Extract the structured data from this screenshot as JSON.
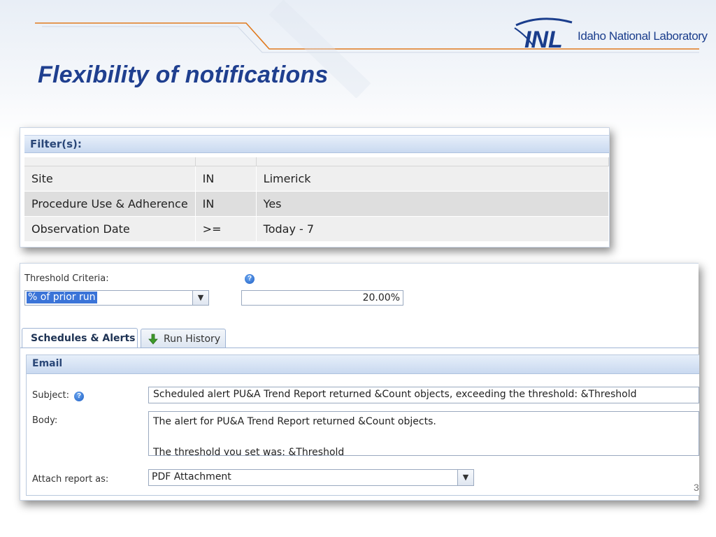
{
  "slide": {
    "title": "Flexibility of notifications",
    "logo_abbrev": "INL",
    "logo_text": "Idaho National Laboratory",
    "page_number": "3",
    "colors": {
      "title": "#1f3f8f",
      "accent_line": "#e07a1f",
      "header_fill": "#c9d9f0"
    }
  },
  "filters": {
    "header": "Filter(s):",
    "rows": [
      {
        "field": "Site",
        "operator": "IN",
        "value": "Limerick"
      },
      {
        "field": "Procedure Use & Adherence",
        "operator": "IN",
        "value": "Yes"
      },
      {
        "field": "Observation Date",
        "operator": ">=",
        "value": "Today - 7"
      }
    ]
  },
  "threshold": {
    "label": "Threshold Criteria:",
    "selected": "% of prior run",
    "value": "20.00%",
    "help_icon": "help-icon"
  },
  "tabs": [
    {
      "label": "Schedules & Alerts",
      "active": true
    },
    {
      "label": "Run History",
      "active": false,
      "icon": "download-arrow-icon"
    }
  ],
  "email": {
    "header": "Email",
    "subject_label": "Subject:",
    "subject_value": "Scheduled alert PU&A Trend Report returned &Count objects, exceeding the threshold: &Threshold",
    "body_label": "Body:",
    "body_line1": "The alert for PU&A Trend Report returned &Count objects.",
    "body_line2": "The threshold you set was: &Threshold",
    "attach_label": "Attach report as:",
    "attach_value": "PDF Attachment"
  }
}
